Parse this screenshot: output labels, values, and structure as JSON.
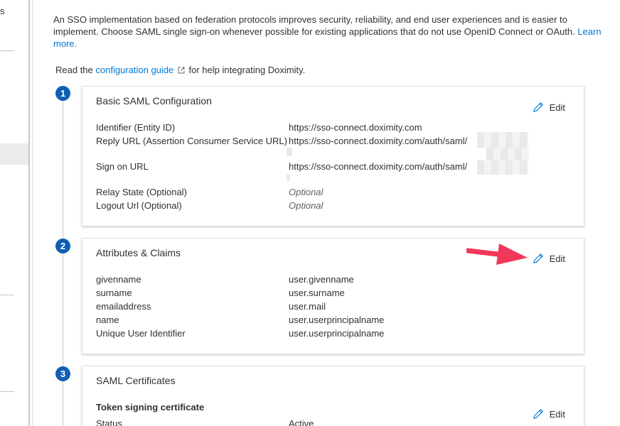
{
  "sidebar": {
    "fragment": "s"
  },
  "intro": {
    "text": "An SSO implementation based on federation protocols improves security, reliability, and end user experiences and is easier to implement. Choose SAML single sign-on whenever possible for existing applications that do not use OpenID Connect or OAuth.",
    "learn_more": "Learn more."
  },
  "guide": {
    "prefix": "Read the",
    "link": "configuration guide",
    "suffix": "for help integrating Doximity."
  },
  "sections": [
    {
      "step": "1",
      "title": "Basic SAML Configuration",
      "edit": "Edit",
      "rows": [
        {
          "key": "Identifier (Entity ID)",
          "value": "https://sso-connect.doximity.com"
        },
        {
          "key": "Reply URL (Assertion Consumer Service URL)",
          "value": "https://sso-connect.doximity.com/auth/saml/"
        },
        {
          "key": "Sign on URL",
          "value": "https://sso-connect.doximity.com/auth/saml/"
        },
        {
          "key": "Relay State (Optional)",
          "value": "Optional"
        },
        {
          "key": "Logout Url (Optional)",
          "value": "Optional"
        }
      ]
    },
    {
      "step": "2",
      "title": "Attributes & Claims",
      "edit": "Edit",
      "rows": [
        {
          "key": "givenname",
          "value": "user.givenname"
        },
        {
          "key": "surname",
          "value": "user.surname"
        },
        {
          "key": "emailaddress",
          "value": "user.mail"
        },
        {
          "key": "name",
          "value": "user.userprincipalname"
        },
        {
          "key": "Unique User Identifier",
          "value": "user.userprincipalname"
        }
      ]
    },
    {
      "step": "3",
      "title": "SAML Certificates",
      "edit": "Edit",
      "subheading": "Token signing certificate",
      "rows": [
        {
          "key": "Status",
          "value": "Active"
        }
      ]
    }
  ],
  "colors": {
    "accent": "#0078d4",
    "step": "#0f5fb3",
    "arrow": "#f2385a"
  }
}
